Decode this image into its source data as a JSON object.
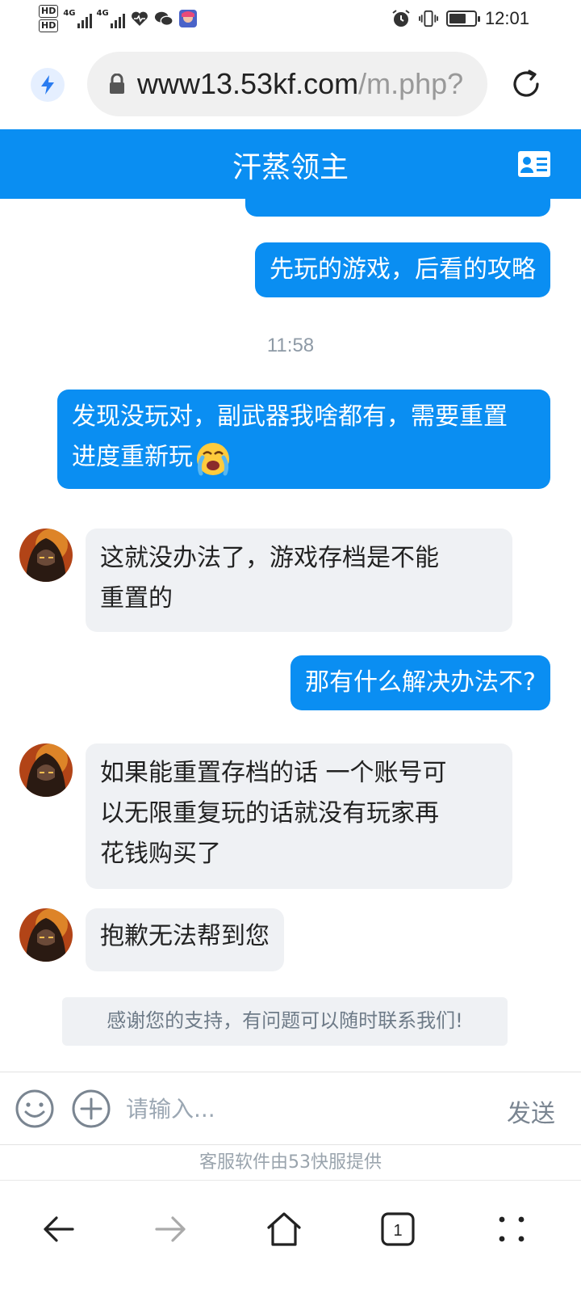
{
  "status_bar": {
    "hd1": "HD",
    "hd2": "HD",
    "net1": "4G",
    "net2": "4G",
    "time": "12:01",
    "icons": [
      "heart-monitor-icon",
      "wechat-icon",
      "app-icon",
      "alarm-icon",
      "vibrate-icon",
      "battery-icon"
    ]
  },
  "browser": {
    "url_main": "www13.53kf.com",
    "url_tail": "/m.php?",
    "icons": [
      "bolt-icon",
      "lock-icon",
      "reload-icon"
    ]
  },
  "header": {
    "title": "汗蒸领主",
    "icon": "contact-card-icon"
  },
  "messages": [
    {
      "from": "me",
      "text": "先玩的游戏，后看的攻略"
    },
    {
      "type": "time",
      "text": "11:58"
    },
    {
      "from": "me",
      "lines": [
        "发现没玩对，副武器我啥都有，需要重置",
        "进度重新玩"
      ],
      "emoji": "crying-face-emoji"
    },
    {
      "from": "agent",
      "lines": [
        "这就没办法了，游戏存档是不能",
        "重置的"
      ]
    },
    {
      "from": "me",
      "text": "那有什么解决办法不?"
    },
    {
      "from": "agent",
      "lines": [
        "如果能重置存档的话 一个账号可",
        "以无限重复玩的话就没有玩家再",
        "花钱购买了"
      ]
    },
    {
      "from": "agent",
      "text": "抱歉无法帮到您"
    }
  ],
  "notice": "感谢您的支持，有问题可以随时联系我们!",
  "input": {
    "placeholder": "请输入...",
    "value": "",
    "send_label": "发送"
  },
  "powered_by": "客服软件由53快服提供",
  "nav": {
    "tab_count": "1",
    "icons": [
      "back-icon",
      "forward-icon",
      "home-icon",
      "tabs-icon",
      "more-icon"
    ]
  },
  "colors": {
    "brand_blue": "#0a8ef2",
    "incoming_bg": "#eff1f4",
    "muted_text": "#8e9aa6"
  }
}
